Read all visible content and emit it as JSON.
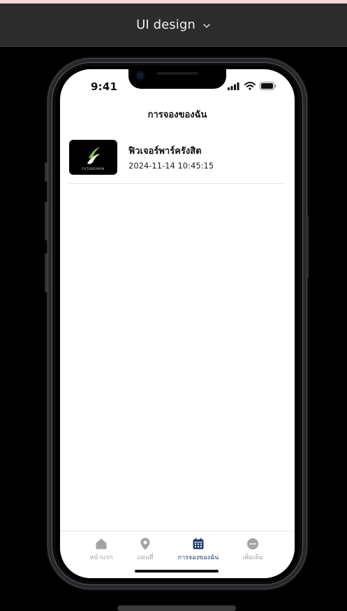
{
  "topbar": {
    "title": "UI design"
  },
  "status": {
    "time": "9:41"
  },
  "page": {
    "title": "การจองของฉัน"
  },
  "bookings": [
    {
      "name": "ฟิวเจอร์พาร์ครังสิต",
      "datetime": "2024-11-14 10:45:15",
      "thumb_text": "FUTUREPARK"
    }
  ],
  "tabs": [
    {
      "label": "หน้าแรก",
      "icon": "home-icon",
      "active": false
    },
    {
      "label": "แผนที่",
      "icon": "map-pin-icon",
      "active": false
    },
    {
      "label": "การจองของฉัน",
      "icon": "calendar-icon",
      "active": true
    },
    {
      "label": "เพิ่มเติม",
      "icon": "more-icon",
      "active": false
    }
  ],
  "colors": {
    "accent": "#1f3b6f",
    "inactive": "#a3a3a3",
    "topbar": "#2c2c2c"
  }
}
